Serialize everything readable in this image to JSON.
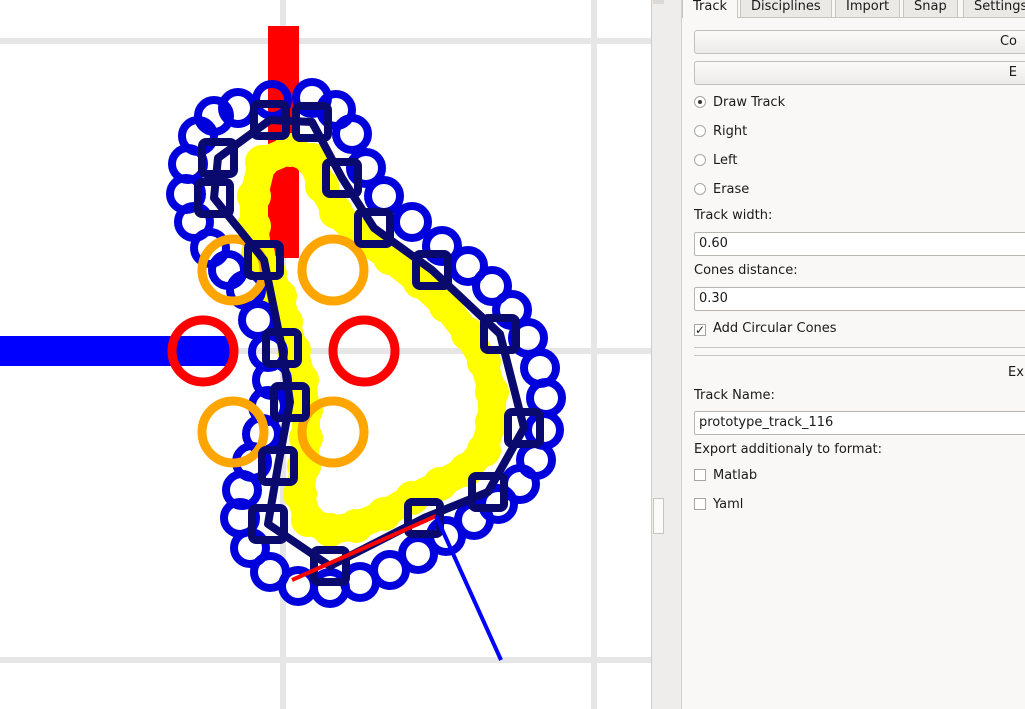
{
  "canvas": {
    "colors": {
      "grid": "#e6e6e6",
      "axis_red": "#ff0000",
      "axis_blue": "#0000ff",
      "track_yellow": "#ffff00",
      "cone_blue": "#0000dd",
      "cone_orange": "#ffa500",
      "path_navy": "#0a0a6e",
      "start_red": "#ff0000"
    },
    "elements": [
      "grid",
      "x-axis",
      "y-axis",
      "yellow-track",
      "blue-cones",
      "orange-cones",
      "red-start-cones",
      "track-path",
      "control-points",
      "start-line",
      "direction-line"
    ]
  },
  "tabs": [
    {
      "label": "Track",
      "active": true
    },
    {
      "label": "Disciplines",
      "active": false
    },
    {
      "label": "Import",
      "active": false
    },
    {
      "label": "Snap",
      "active": false
    },
    {
      "label": "Settings",
      "active": false
    }
  ],
  "buttons": {
    "first": "Co",
    "second": "E"
  },
  "modes": {
    "draw_track": "Draw Track",
    "right": "Right",
    "left": "Left",
    "erase": "Erase",
    "selected": "Draw Track"
  },
  "track_width": {
    "label": "Track width:",
    "value": "0.60"
  },
  "cones_distance": {
    "label": "Cones distance:",
    "value": "0.30"
  },
  "add_circular_cones": {
    "label": "Add Circular Cones",
    "checked": true,
    "mark": "✓"
  },
  "export_section": {
    "title": "Ex"
  },
  "track_name": {
    "label": "Track Name:",
    "value": "prototype_track_116"
  },
  "export_formats": {
    "label": "Export additionaly to format:",
    "matlab": {
      "label": "Matlab",
      "checked": false
    },
    "yaml": {
      "label": "Yaml",
      "checked": false
    }
  }
}
